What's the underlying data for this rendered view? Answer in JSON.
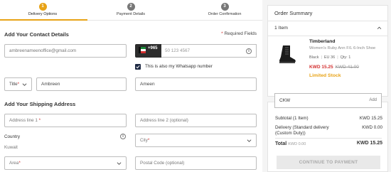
{
  "steps": [
    {
      "num": "1",
      "label": "Delivery Options"
    },
    {
      "num": "2",
      "label": "Payment Details"
    },
    {
      "num": "3",
      "label": "Order Confirmation"
    }
  ],
  "contact": {
    "title": "Add Your Contact Details",
    "required_note": "Required Fields",
    "email_placeholder": "ambreenameenoffice@gmail.com",
    "phone_code": "+965",
    "phone_placeholder": "50 123 4567",
    "whatsapp_label": "This is also my Whatsapp number",
    "title_select": "Title",
    "first_name": "Ambreen",
    "last_name": "Ameen"
  },
  "shipping": {
    "title": "Add Your Shipping Address",
    "address1": "Address line 1",
    "address2": "Address line 2 (optional)",
    "country_label": "Country",
    "country_value": "Kuwait",
    "city": "City",
    "area": "Area",
    "postal": "Postal Code (optional)"
  },
  "summary": {
    "title": "Order Summary",
    "item_count": "1 Item",
    "product": {
      "brand": "Timberland",
      "name": "Women's Ruby Ann F/L 6-Inch Shoe",
      "color": "Black",
      "size": "EU 36",
      "qty": "Qty: 1",
      "price_now": "KWD 15.25",
      "price_was": "KWD 41.00",
      "stock_note": "Limited Stock"
    },
    "coupon": {
      "code": "CKW",
      "add_label": "Add"
    },
    "subtotal_label": "Subtotal (1 Item)",
    "subtotal_value": "KWD 15.25",
    "delivery_label": "Delivery (Standard delivery (Custom Duty))",
    "delivery_value": "KWD 0.00",
    "total_label": "Total",
    "total_sub": "KWD 0.00",
    "total_value": "KWD 15.25",
    "continue_label": "CONTINUE TO PAYMENT"
  },
  "colors": {
    "accent": "#e8a317",
    "sale": "#d32f2f",
    "dark": "#2d2d2d"
  }
}
